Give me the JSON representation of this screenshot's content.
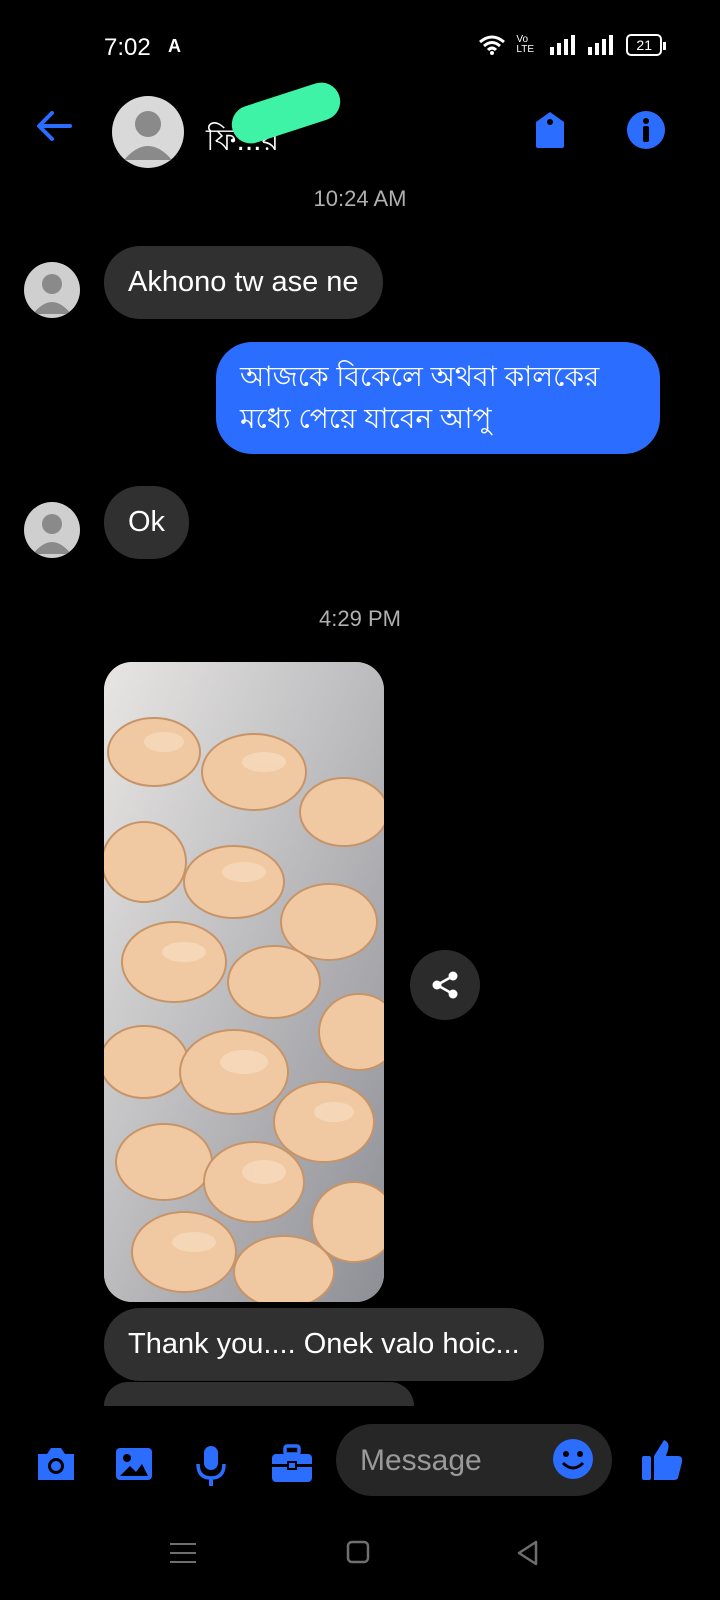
{
  "status_bar": {
    "time": "7:02",
    "app_glyph": "A",
    "battery": "21",
    "volte": "Vo LTE"
  },
  "header": {
    "contact_name": "ফি...য়",
    "icons": [
      "back-arrow-icon",
      "tag-icon",
      "info-icon"
    ]
  },
  "conversation": {
    "timestamp_1": "10:24 AM",
    "msg_1": "Akhono tw ase ne",
    "msg_2_line1": "আজকে বিকেলে অথবা কালকের",
    "msg_2_line2": "মধ্যে পেয়ে যাবেন আপু",
    "msg_3": "Ok",
    "timestamp_2": "4:29 PM",
    "msg_4": "Thank you.... Onek valo hoic..."
  },
  "composer": {
    "placeholder": "Message"
  },
  "colors": {
    "accent": "#2a6dff",
    "incoming_bubble": "#303030",
    "redaction": "#3ef3a6"
  }
}
